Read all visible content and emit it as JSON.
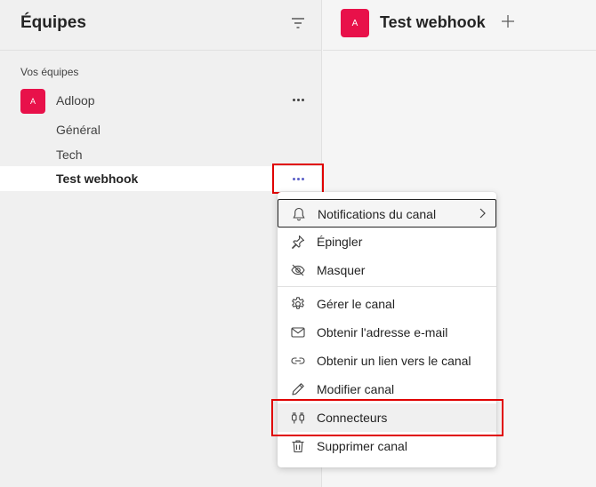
{
  "sidebar": {
    "title": "Équipes",
    "section_label": "Vos équipes",
    "team": {
      "avatar_letter": "A",
      "name": "Adloop"
    },
    "channels": [
      {
        "label": "Général"
      },
      {
        "label": "Tech"
      },
      {
        "label": "Test webhook",
        "active": true
      }
    ]
  },
  "header": {
    "avatar_letter": "A",
    "title": "Test webhook"
  },
  "context_menu": {
    "items": [
      {
        "label": "Notifications du canal",
        "icon": "bell-icon",
        "has_submenu": true
      },
      {
        "label": "Épingler",
        "icon": "pin-icon"
      },
      {
        "label": "Masquer",
        "icon": "eye-off-icon"
      },
      {
        "label": "Gérer le canal",
        "icon": "gear-icon"
      },
      {
        "label": "Obtenir l'adresse e-mail",
        "icon": "mail-icon"
      },
      {
        "label": "Obtenir un lien vers le canal",
        "icon": "link-icon"
      },
      {
        "label": "Modifier canal",
        "icon": "pencil-icon"
      },
      {
        "label": "Connecteurs",
        "icon": "plug-icon"
      },
      {
        "label": "Supprimer canal",
        "icon": "trash-icon"
      }
    ]
  },
  "colors": {
    "accent": "#5b5fc7",
    "avatar": "#e8114a",
    "highlight": "#e00000"
  }
}
